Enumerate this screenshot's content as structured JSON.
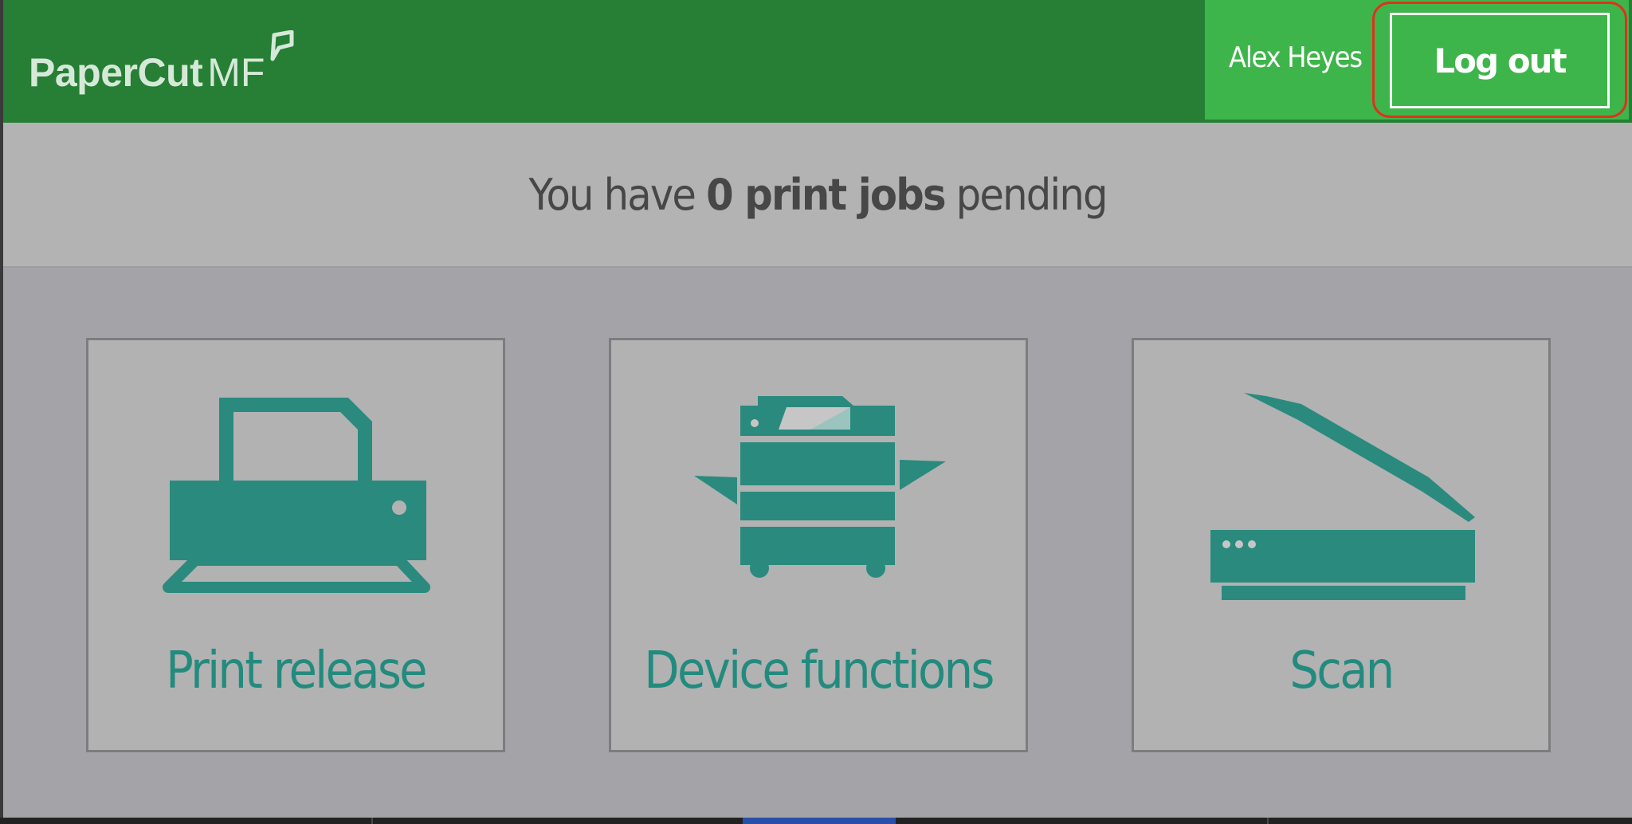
{
  "app": {
    "logo_text": "PaperCut",
    "logo_suffix": "MF"
  },
  "header": {
    "user_name": "Alex Heyes",
    "logout_label": "Log out"
  },
  "banner": {
    "prefix": "You have",
    "count_text": "0 print jobs",
    "suffix": "pending"
  },
  "tiles": [
    {
      "label": "Print release",
      "icon": "printer-icon"
    },
    {
      "label": "Device functions",
      "icon": "copier-icon"
    },
    {
      "label": "Scan",
      "icon": "scanner-icon"
    }
  ],
  "colors": {
    "header_green": "#267f35",
    "user_panel_green": "#3db54a",
    "accent_teal": "#2a8a7e",
    "highlight_red": "#e0301e"
  }
}
